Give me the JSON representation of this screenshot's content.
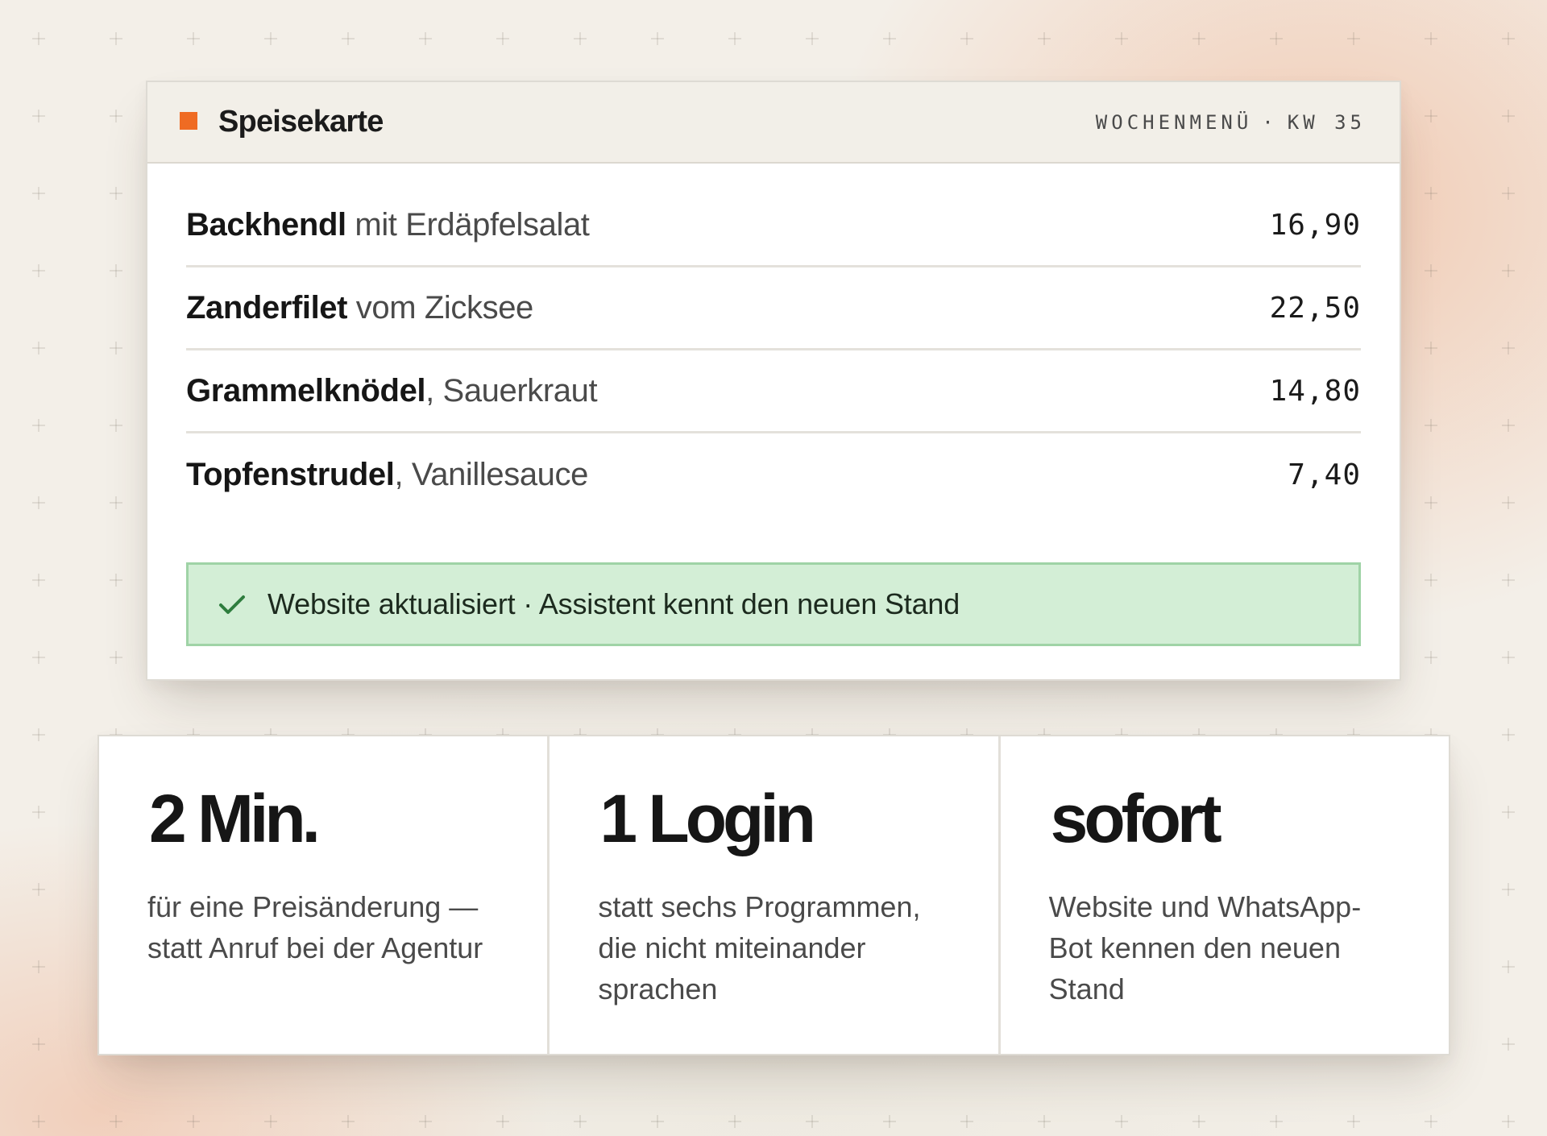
{
  "menu": {
    "title": "Speisekarte",
    "week_label": "WOCHENMENÜ",
    "week_separator": "·",
    "week_number": "KW 35",
    "items": [
      {
        "name": "Backhendl",
        "desc": " mit Erdäpfelsalat",
        "price": "16,90"
      },
      {
        "name": "Zanderfilet",
        "desc": " vom Zicksee",
        "price": "22,50"
      },
      {
        "name": "Grammelknödel",
        "desc": ", Sauerkraut",
        "price": "14,80"
      },
      {
        "name": "Topfenstrudel",
        "desc": ", Vanillesauce",
        "price": "7,40"
      }
    ],
    "status": {
      "icon": "check-icon",
      "text": "Website aktualisiert · Assistent kennt den neuen Stand"
    }
  },
  "stats": [
    {
      "value": "2 Min.",
      "text": "für eine Preisänderung — statt Anruf bei der Agentur"
    },
    {
      "value": "1 Login",
      "text": "statt sechs Programmen, die nicht miteinander sprachen"
    },
    {
      "value": "sofort",
      "text": "Website und WhatsApp-Bot kennen den neuen Stand"
    }
  ],
  "colors": {
    "accent": "#ef6b23",
    "success_bg": "#d3eed6",
    "success_border": "#9fd3a6",
    "success_icon": "#2e7d3e",
    "background": "#f3efe8"
  }
}
